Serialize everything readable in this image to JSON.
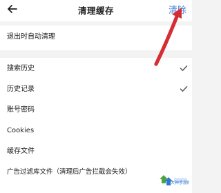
{
  "header": {
    "title": "清理缓存",
    "action_label": "清除"
  },
  "settings": {
    "auto_clear_label": "退出时自动清理"
  },
  "items": [
    {
      "label": "搜索历史",
      "checked": true
    },
    {
      "label": "历史记录",
      "checked": true
    },
    {
      "label": "账号密码",
      "checked": false
    },
    {
      "label": "Cookies",
      "checked": false
    },
    {
      "label": "缓存文件",
      "checked": false
    },
    {
      "label": "广告过滤库文件（清理后广告拦截会失效）",
      "checked": false
    }
  ],
  "watermark": {
    "text": "大神手游网"
  },
  "colors": {
    "accent": "#4a86d9",
    "annotation": "#d42d34"
  }
}
